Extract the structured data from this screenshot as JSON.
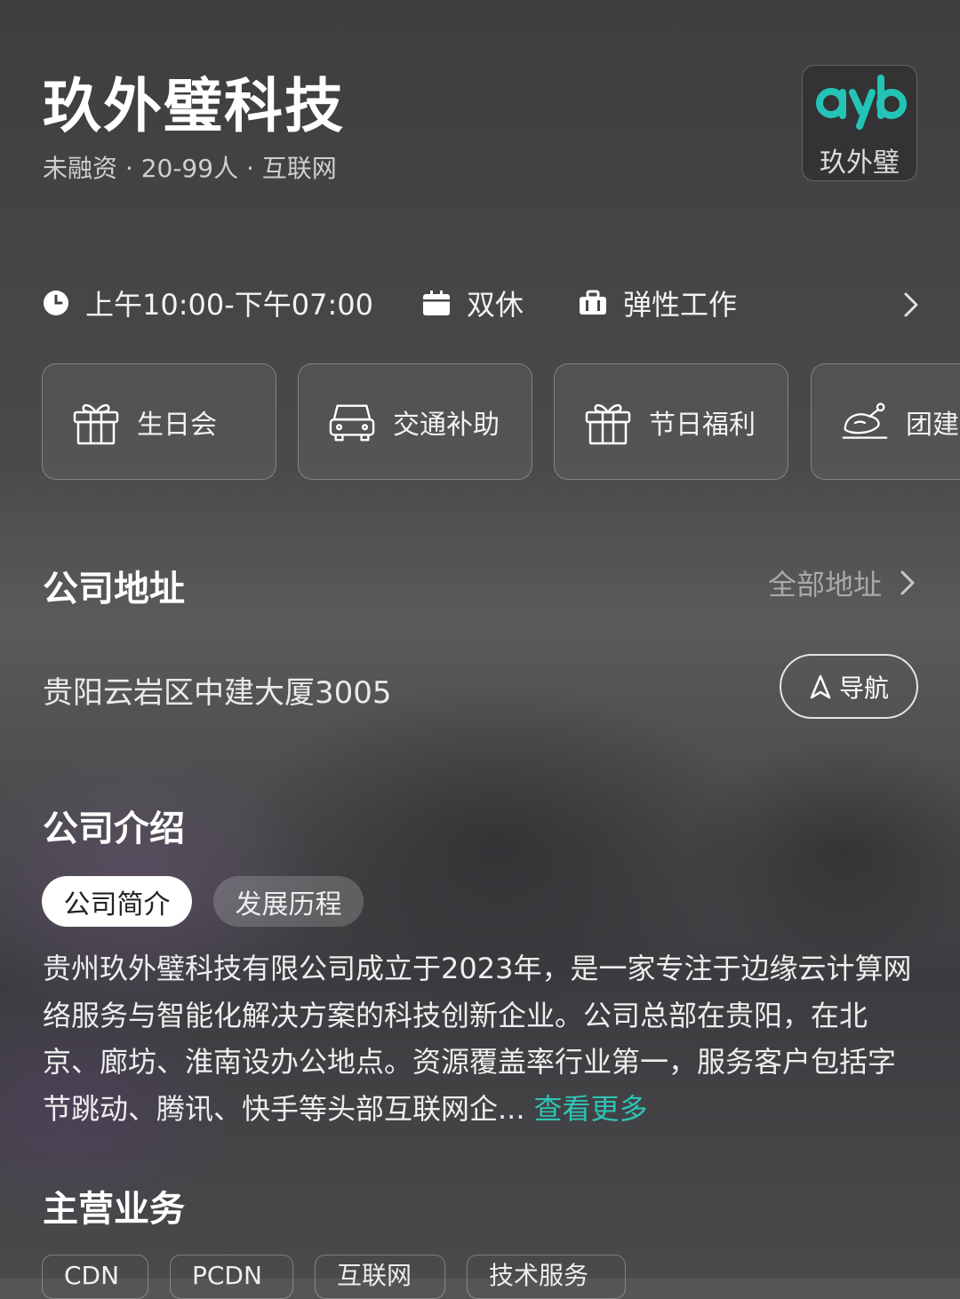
{
  "company": {
    "name": "玖外璧科技",
    "meta": "未融资 · 20-99人 · 互联网",
    "logo_text": "玖外璧",
    "logo_mark": "ayb",
    "brand_color": "#23c4b6"
  },
  "info_row": {
    "hours": "上午10:00-下午07:00",
    "weekend": "双休",
    "work_mode": "弹性工作"
  },
  "benefits": [
    {
      "icon": "gift-icon",
      "label": "生日会"
    },
    {
      "icon": "car-icon",
      "label": "交通补助"
    },
    {
      "icon": "gift-icon",
      "label": "节日福利"
    },
    {
      "icon": "roast-chicken-icon",
      "label": "团建"
    }
  ],
  "address_section": {
    "title": "公司地址",
    "all_link": "全部地址",
    "address": "贵阳云岩区中建大厦3005",
    "nav_label": "导航"
  },
  "intro_section": {
    "title": "公司介绍",
    "tabs": [
      {
        "label": "公司简介",
        "active": true
      },
      {
        "label": "发展历程",
        "active": false
      }
    ],
    "text": "贵州玖外璧科技有限公司成立于2023年，是一家专注于边缘云计算网络服务与智能化解决方案的科技创新企业。公司总部在贵阳，在北京、廊坊、淮南设办公地点。资源覆盖率行业第一，服务客户包括字节跳动、腾讯、快手等头部互联网企...",
    "more_link": "查看更多",
    "more_color": "#2ec4b6"
  },
  "business_section": {
    "title": "主营业务",
    "chips": [
      "CDN",
      "PCDN",
      "互联网",
      "技术服务"
    ]
  }
}
